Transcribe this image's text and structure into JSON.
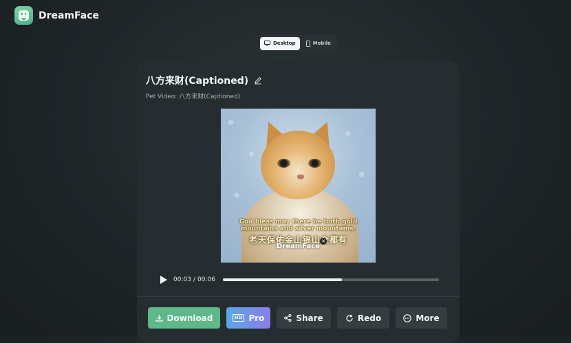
{
  "app": {
    "name": "DreamFace"
  },
  "view_toggle": {
    "options": [
      {
        "label": "Desktop",
        "icon": "desktop-icon",
        "active": true
      },
      {
        "label": "Mobile",
        "icon": "mobile-icon",
        "active": false
      }
    ]
  },
  "video_card": {
    "title": "八方来财(Captioned)",
    "subtitle": "Pet Video: 八方来财(Captioned)",
    "captions": {
      "english_line1": "God bless may there be both gold",
      "english_line2": "mountains and silver mountains.",
      "chinese": "老天保佑金山银山全都有"
    },
    "watermark": "DreamFace",
    "player": {
      "current_time": "00:03",
      "separator": "/",
      "duration": "00:06",
      "progress": 0.55
    }
  },
  "actions": {
    "download": "Download",
    "pro_badge": "HD",
    "pro": "Pro",
    "share": "Share",
    "redo": "Redo",
    "more": "More"
  },
  "colors": {
    "download": "#5fb889",
    "pro_start": "#5aa7e6",
    "pro_end": "#8a7ee8",
    "background": "#1f2528",
    "card": "#262d30"
  }
}
